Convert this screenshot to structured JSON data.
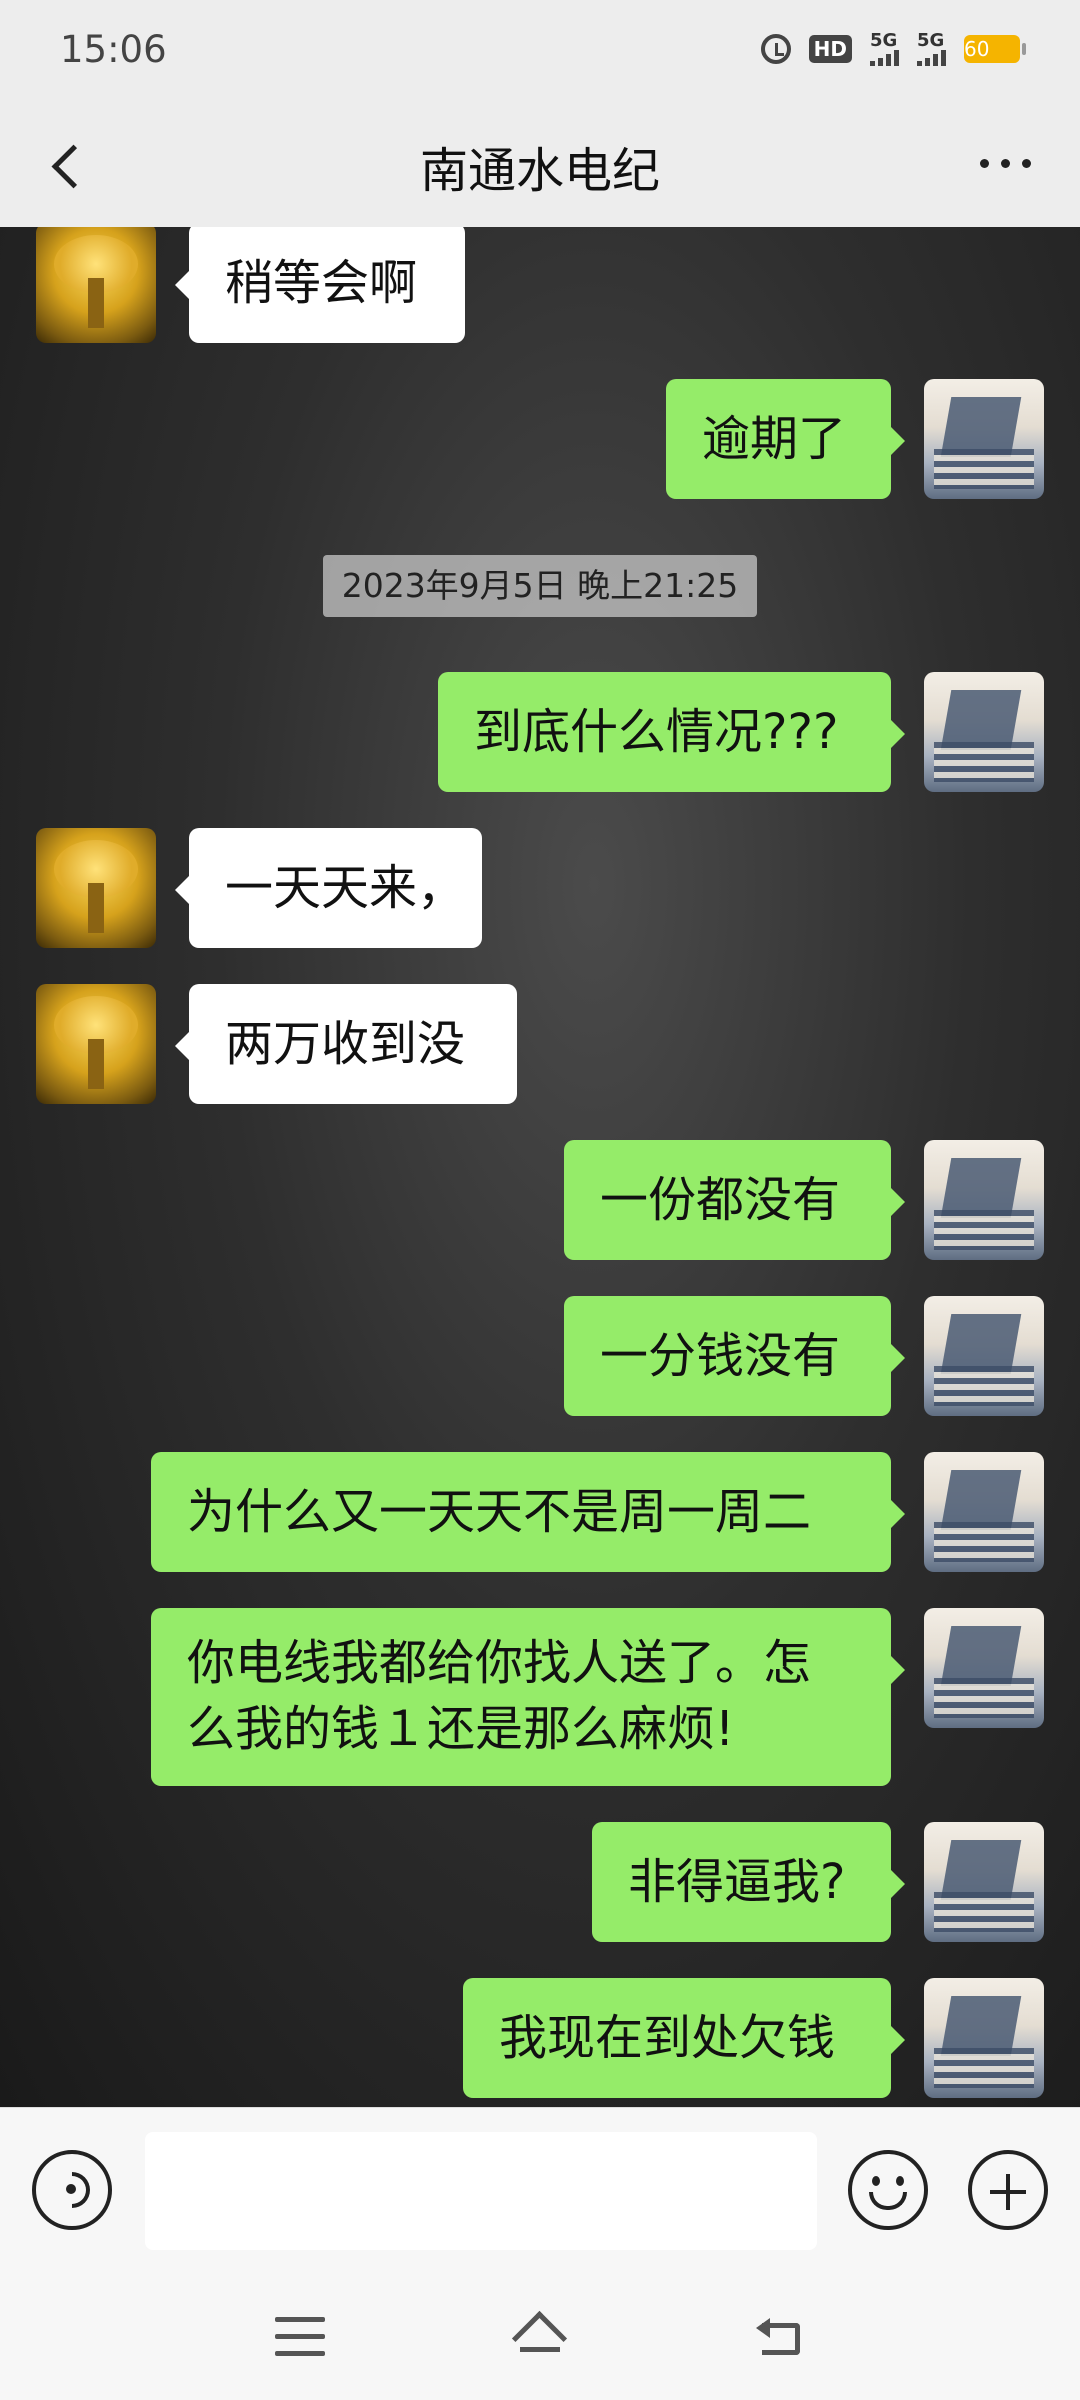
{
  "status_bar": {
    "time": "15:06",
    "hd_label": "HD",
    "sim1_label": "5G",
    "sim2_label": "5G",
    "battery": "60"
  },
  "header": {
    "title": "南通水电纪"
  },
  "chat": {
    "timestamp": "2023年9月5日 晚上21:25",
    "messages": [
      {
        "side": "left",
        "text": "稍等会啊"
      },
      {
        "side": "right",
        "text": "逾期了"
      },
      {
        "side": "right",
        "text": "到底什么情况???"
      },
      {
        "side": "left",
        "text": "一天天来，"
      },
      {
        "side": "left",
        "text": "两万收到没"
      },
      {
        "side": "right",
        "text": "一份都没有"
      },
      {
        "side": "right",
        "text": "一分钱没有"
      },
      {
        "side": "right",
        "text": "为什么又一天天不是周一周二"
      },
      {
        "side": "right",
        "text": "你电线我都给你找人送了。怎么我的钱１还是那么麻烦!"
      },
      {
        "side": "right",
        "text": "非得逼我?"
      },
      {
        "side": "right",
        "text": "我现在到处欠钱"
      }
    ]
  },
  "input": {
    "value": "",
    "placeholder": ""
  },
  "icons": {
    "back": "chevron-left-icon",
    "more": "more-dots-icon",
    "voice": "voice-icon",
    "emoji": "emoji-icon",
    "plus": "plus-icon",
    "nav_menu": "menu-icon",
    "nav_home": "home-icon",
    "nav_back": "back-icon"
  },
  "colors": {
    "my_bubble": "#95ec69",
    "their_bubble": "#ffffff",
    "header_bg": "#ededed"
  }
}
